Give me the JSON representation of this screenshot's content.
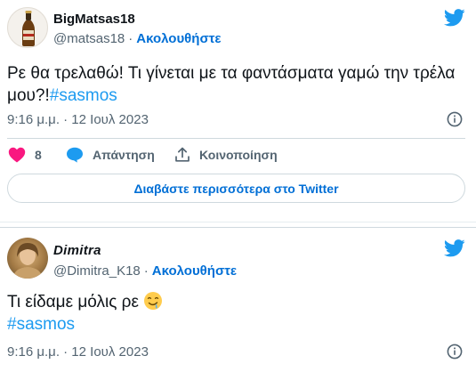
{
  "tweets": [
    {
      "display_name": "BigMatsas18",
      "handle": "@matsas18",
      "follow_label": "Ακολουθήστε",
      "separator": "·",
      "text": "Ρε θα τρελαθώ! Τι γίνεται με τα φαντάσματα γαμώ την τρέλα μου?!",
      "hashtag": "#sasmos",
      "timestamp": "9:16 μ.μ. · 12 Ιουλ 2023",
      "like_count": "8",
      "reply_label": "Απάντηση",
      "share_label": "Κοινοποίηση",
      "read_more_label": "Διαβάστε περισσότερα στο Twitter"
    },
    {
      "display_name": "Dimitra",
      "handle": "@Dimitra_K18",
      "follow_label": "Ακολουθήστε",
      "separator": "·",
      "text": "Τι είδαμε μόλις ρε",
      "hashtag": "#sasmos",
      "timestamp": "9:16 μ.μ. · 12 Ιουλ 2023"
    }
  ],
  "icons": [
    "twitter-bird-icon",
    "info-icon",
    "heart-icon",
    "reply-bubble-icon",
    "share-icon",
    "drooling-face-emoji"
  ],
  "colors": {
    "link": "#1d9bf0",
    "follow": "#006fd6",
    "heart": "#f91880",
    "secondary_text": "#536471",
    "twitter_blue": "#1d9bf0"
  }
}
